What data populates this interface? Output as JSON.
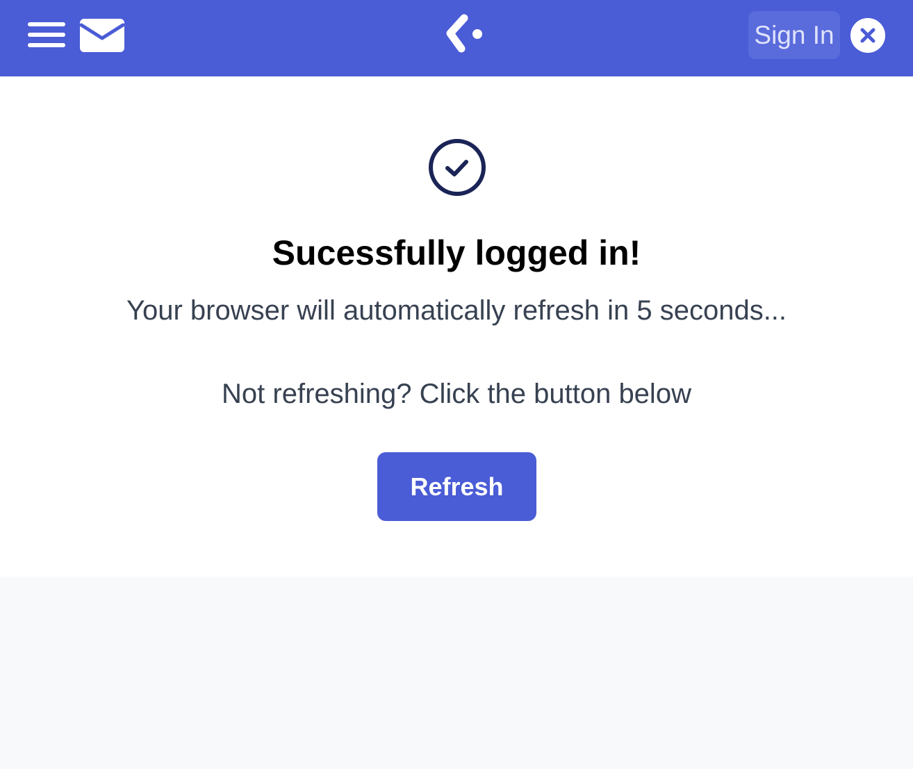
{
  "header": {
    "menu_icon": "hamburger-menu-icon",
    "mail_icon": "envelope-icon",
    "logo_icon": "app-logo-icon",
    "signin_label": "Sign In",
    "close_icon": "close-icon"
  },
  "main": {
    "status_icon": "check-circle-icon",
    "title": "Sucessfully logged in!",
    "subtitle": "Your browser will automatically refresh in 5 seconds...",
    "hint": "Not refreshing? Click the button below",
    "refresh_label": "Refresh"
  },
  "colors": {
    "brand": "#4a5cd6",
    "signin_bg": "#5a6bdc",
    "icon_dark": "#1a2456",
    "text_body": "#374151",
    "page_bg": "#f8f9fb"
  }
}
